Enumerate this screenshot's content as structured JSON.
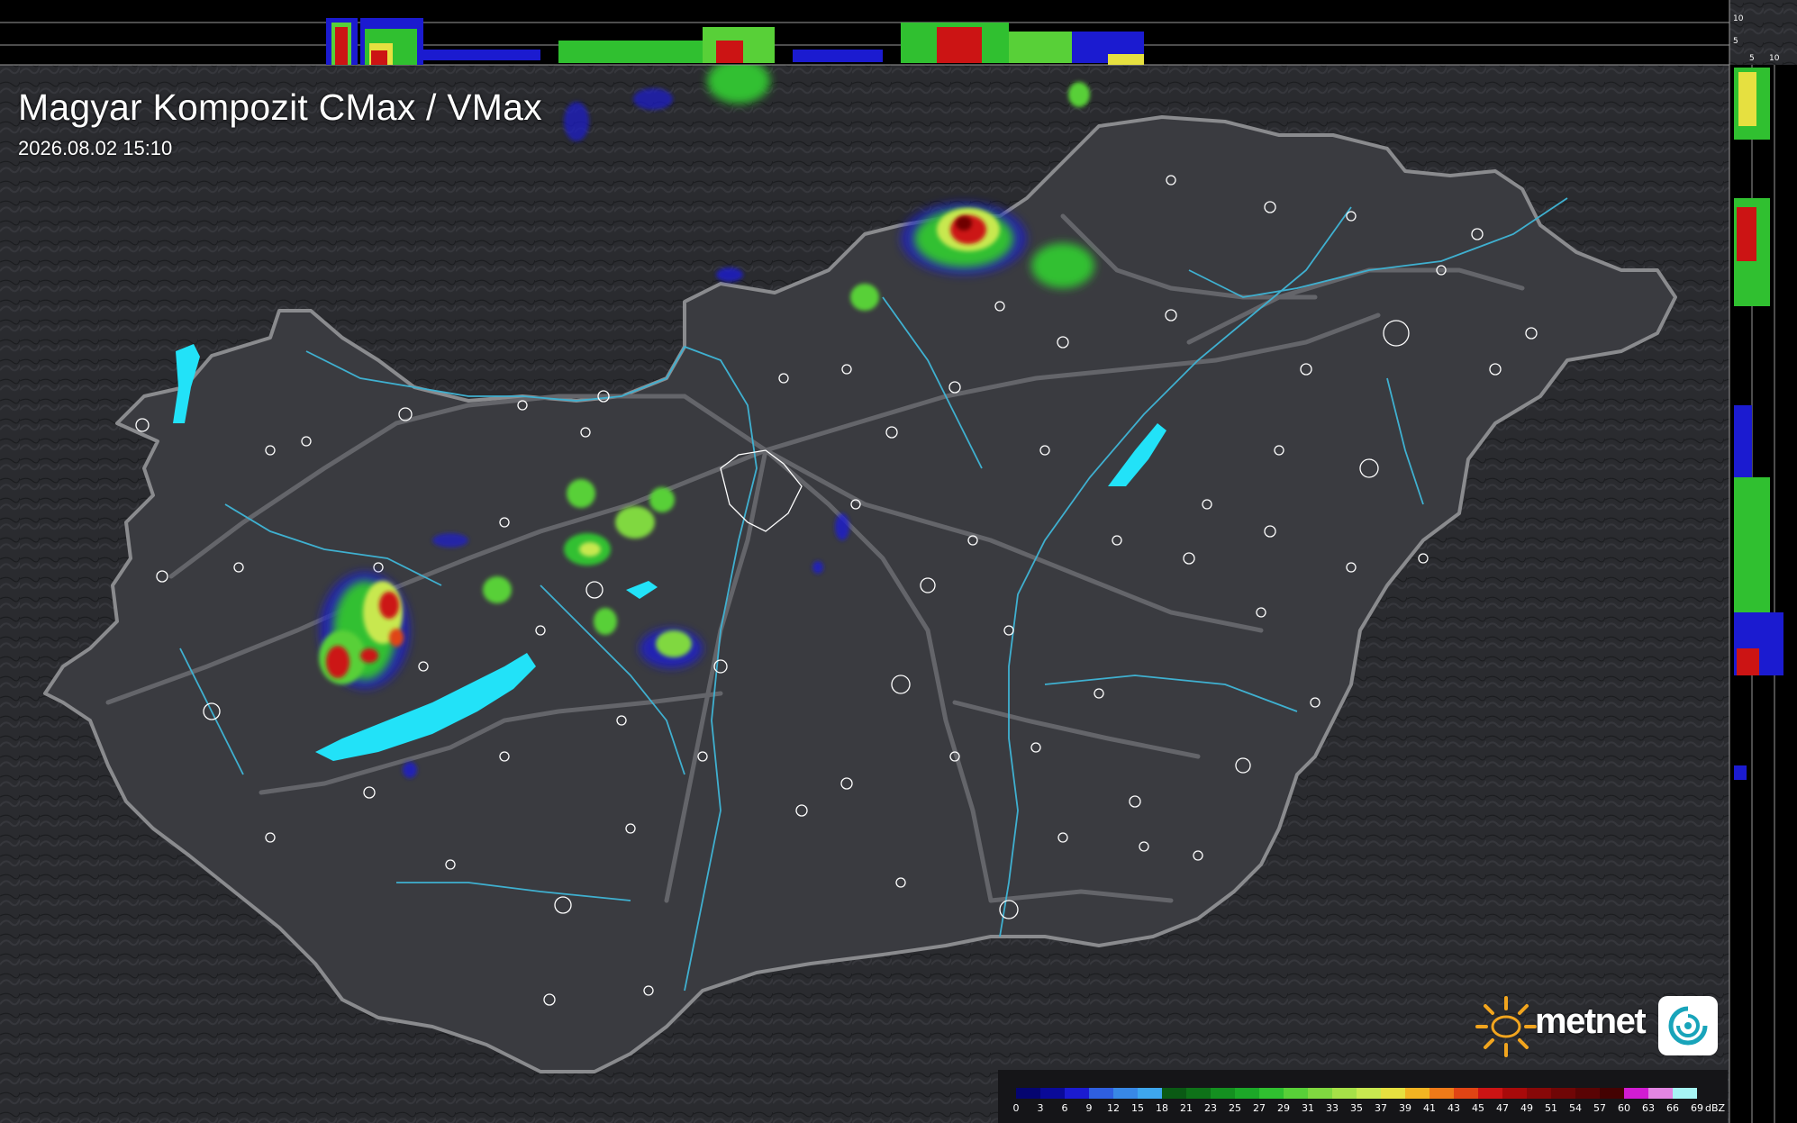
{
  "header": {
    "title": "Magyar Kompozit CMax / VMax",
    "timestamp": "2026.08.02 15:10"
  },
  "profiles": {
    "top_axis_labels": [
      "10",
      "5"
    ],
    "right_axis_labels": [
      "5",
      "10"
    ]
  },
  "branding": {
    "logo_text": "metnet",
    "logo_icon": "metnet-swirl-icon",
    "sun_icon": "sun-rays-icon"
  },
  "legend": {
    "unit": "dBZ",
    "ticks": [
      "0",
      "3",
      "6",
      "9",
      "12",
      "15",
      "18",
      "21",
      "23",
      "25",
      "27",
      "29",
      "31",
      "33",
      "35",
      "37",
      "39",
      "41",
      "43",
      "45",
      "47",
      "49",
      "51",
      "54",
      "57",
      "60",
      "63",
      "66",
      "69"
    ],
    "colors": [
      "#050570",
      "#0a0a98",
      "#1b1bd0",
      "#2f5fe0",
      "#3888e6",
      "#3ea6ee",
      "#0a5a14",
      "#0e7218",
      "#149020",
      "#1ca828",
      "#30c030",
      "#58d038",
      "#80d840",
      "#a6e048",
      "#c8e850",
      "#e6e040",
      "#f2b422",
      "#ee7a18",
      "#e04414",
      "#cc1414",
      "#a80a0a",
      "#880808",
      "#700606",
      "#5a0404",
      "#440202",
      "#d21cd2",
      "#e286e2",
      "#a6f4f4"
    ]
  },
  "colors": {
    "background": "#26272b",
    "country_fill": "#3a3b40",
    "border": "#8a8b8e",
    "roads": "#6a6b6e",
    "rivers": "#3fb0d0",
    "lakes": "#22e2f8",
    "settlements": "#ffffff"
  }
}
